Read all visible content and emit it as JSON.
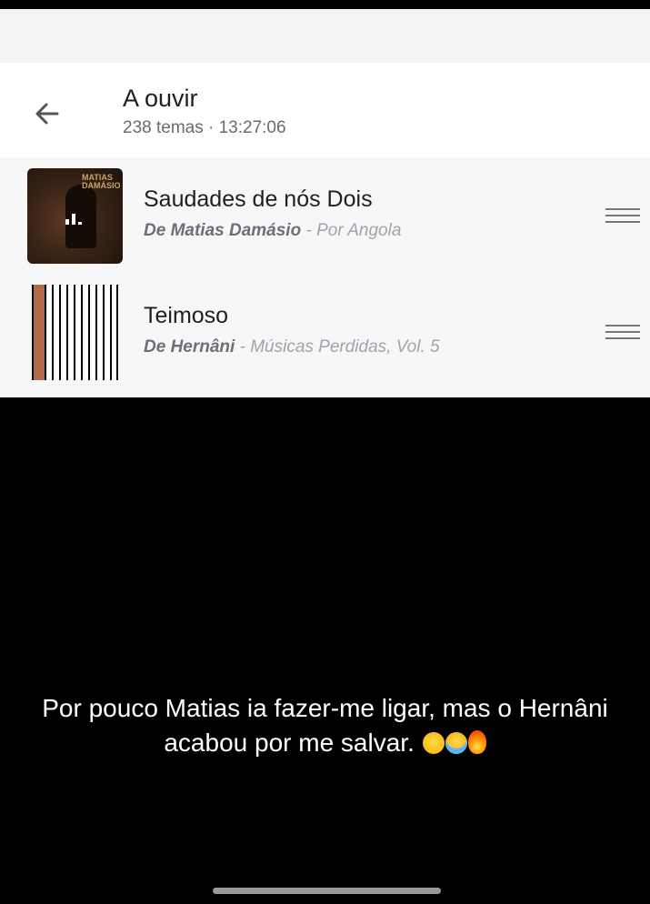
{
  "header": {
    "title": "A ouvir",
    "subtitle": "238 temas · 13:27:06"
  },
  "queue": [
    {
      "title": "Saudades de nós Dois",
      "artist_prefix": "De Matias Damásio",
      "separator": " - ",
      "album": "Por Angola",
      "art_text": "MATIAS DAMÁSIO",
      "now_playing": true
    },
    {
      "title": "Teimoso",
      "artist_prefix": "De Hernâni",
      "separator": " - ",
      "album": "Músicas Perdidas, Vol. 5",
      "now_playing": false
    }
  ],
  "caption": {
    "line1": "Por pouco Matias ia fazer-me ligar, mas o Hernâni",
    "line2": "acabou por me salvar."
  },
  "icons": {
    "back": "arrow-left-icon",
    "drag": "drag-handle-icon",
    "playing": "equalizer-icon",
    "emojis": [
      "face-with-tears-of-joy",
      "loudly-crying-face",
      "fire"
    ]
  },
  "colors": {
    "header_bg": "#ffffff",
    "list_bg": "#f7f7f7",
    "artist": "#6e6e78",
    "album": "#a2a2ae"
  }
}
